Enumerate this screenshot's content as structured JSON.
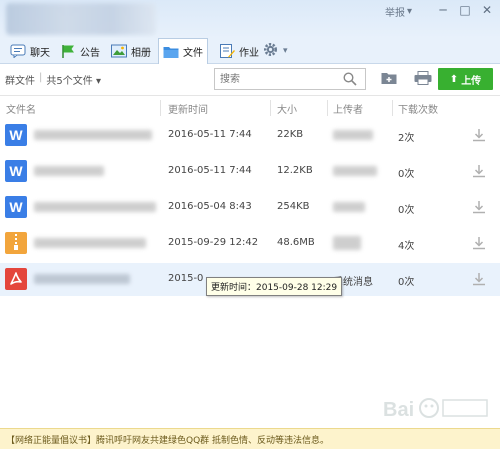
{
  "titlebar": {
    "report_label": "举报",
    "report_arrow": "▾",
    "min_glyph": "─",
    "max_glyph": "□",
    "close_glyph": "✕"
  },
  "tabs": [
    {
      "label": "聊天",
      "icon": "chat-icon"
    },
    {
      "label": "公告",
      "icon": "announcement-icon"
    },
    {
      "label": "相册",
      "icon": "album-icon"
    },
    {
      "label": "文件",
      "icon": "folder-icon",
      "active": true
    },
    {
      "label": "作业",
      "icon": "homework-icon"
    }
  ],
  "settings_arrow": "▾",
  "toolbar": {
    "crumb_root": "群文件",
    "crumb_sep": "|",
    "crumb_count": "共5个文件",
    "crumb_arrow": "▾",
    "search_placeholder": "搜索",
    "upload_label": "上传",
    "upload_glyph": "⬆",
    "accent": "#38b030"
  },
  "table": {
    "columns": [
      "文件名",
      "更新时间",
      "大小",
      "上传者",
      "下载次数"
    ],
    "rows": [
      {
        "type": "word",
        "type_glyph": "W",
        "color": "#3a7ee6",
        "updated": "2016-05-11 7:44",
        "size": "22KB",
        "downloads": "2次"
      },
      {
        "type": "word",
        "type_glyph": "W",
        "color": "#3a7ee6",
        "updated": "2016-05-11 7:44",
        "size": "12.2KB",
        "downloads": "0次"
      },
      {
        "type": "word",
        "type_glyph": "W",
        "color": "#3a7ee6",
        "updated": "2016-05-04 8:43",
        "size": "254KB",
        "downloads": "0次"
      },
      {
        "type": "archive",
        "type_glyph": "",
        "color": "#f2a53c",
        "updated": "2015-09-29 12:42",
        "size": "48.6MB",
        "downloads": "4次"
      },
      {
        "type": "pdf",
        "type_glyph": "",
        "color": "#e4463c",
        "updated": "2015-0",
        "size": "",
        "uploader": "系统消息",
        "downloads": "0次"
      }
    ]
  },
  "tooltip": "更新时间：2015-09-28 12:29",
  "footer": "【网络正能量倡议书】腾讯呼吁网友共建绿色QQ群 抵制色情、反动等违法信息。"
}
